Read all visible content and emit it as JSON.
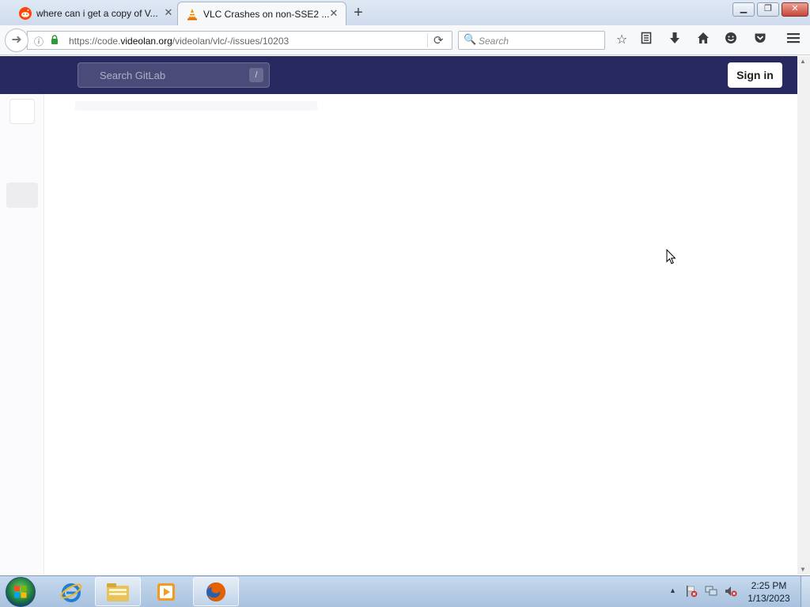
{
  "browser": {
    "tabs": [
      {
        "title": "where can i get a copy of V...",
        "favicon": "reddit-icon",
        "active": false
      },
      {
        "title": "VLC Crashes on non-SSE2 ...",
        "favicon": "vlc-cone-icon",
        "active": true
      }
    ],
    "url": {
      "prefix": "https://code.",
      "host": "videolan.org",
      "path": "/videolan/vlc/-/issues/10203"
    },
    "search_placeholder": "Search"
  },
  "gitlab": {
    "search_placeholder": "Search GitLab",
    "search_shortcut": "/",
    "signin_label": "Sign in",
    "header_color": "#292961"
  },
  "taskbar": {
    "time": "2:25 PM",
    "date": "1/13/2023"
  }
}
